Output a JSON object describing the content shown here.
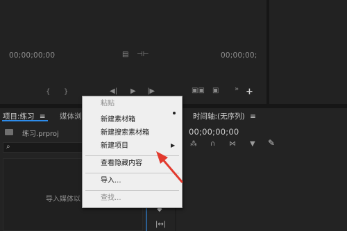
{
  "source_monitor": {
    "timecode": "00;00;00;00"
  },
  "program_monitor": {
    "timecode": "00;00;00;"
  },
  "project_panel": {
    "tab_title": "项目:练习",
    "menu_glyph": "≡",
    "next_tab": "媒体浏",
    "file_name": "练习.prproj",
    "import_hint": "导入媒体以"
  },
  "timeline_panel": {
    "tab_title": "时间轴:(无序列)",
    "menu_glyph": "≡",
    "timecode": "00;00;00;00"
  },
  "context_menu": {
    "paste": "粘贴",
    "new_bin": "新建素材箱",
    "new_search_bin": "新建搜索素材箱",
    "new_item": "新建项目",
    "view_hidden": "查看隐藏内容",
    "import": "导入...",
    "find": "查找..."
  },
  "annotation": {
    "arrow_color": "#e23a2e"
  }
}
